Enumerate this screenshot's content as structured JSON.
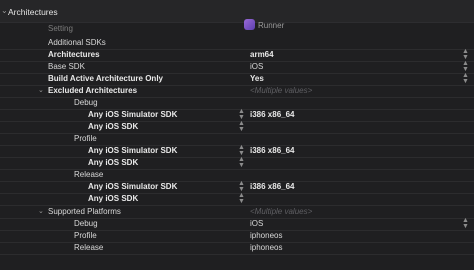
{
  "section": {
    "title": "Architectures"
  },
  "columns": {
    "setting": "Setting",
    "target": "Runner"
  },
  "rows": {
    "additional_sdks": {
      "name": "Additional SDKs",
      "value": ""
    },
    "architectures": {
      "name": "Architectures",
      "value": "arm64"
    },
    "base_sdk": {
      "name": "Base SDK",
      "value": "iOS"
    },
    "build_active_arch": {
      "name": "Build Active Architecture Only",
      "value": "Yes"
    },
    "excluded": {
      "name": "Excluded Architectures",
      "value": "<Multiple values>"
    },
    "ex_debug": {
      "name": "Debug"
    },
    "ex_debug_sim": {
      "name": "Any iOS Simulator SDK",
      "value": "i386 x86_64"
    },
    "ex_debug_sdk": {
      "name": "Any iOS SDK",
      "value": ""
    },
    "ex_profile": {
      "name": "Profile"
    },
    "ex_profile_sim": {
      "name": "Any iOS Simulator SDK",
      "value": "i386 x86_64"
    },
    "ex_profile_sdk": {
      "name": "Any iOS SDK",
      "value": ""
    },
    "ex_release": {
      "name": "Release"
    },
    "ex_release_sim": {
      "name": "Any iOS Simulator SDK",
      "value": "i386 x86_64"
    },
    "ex_release_sdk": {
      "name": "Any iOS SDK",
      "value": ""
    },
    "supported": {
      "name": "Supported Platforms",
      "value": "<Multiple values>"
    },
    "sp_debug": {
      "name": "Debug",
      "value": "iOS"
    },
    "sp_profile": {
      "name": "Profile",
      "value": "iphoneos"
    },
    "sp_release": {
      "name": "Release",
      "value": "iphoneos"
    }
  },
  "icons": {
    "section_disclosure": "chevron-down-icon",
    "target": "app-target-icon",
    "stepper": "up-down-stepper-icon"
  },
  "colors": {
    "background": "#1f1f21",
    "header": "#262628",
    "bold_text": "#e9e9e9",
    "placeholder": "#5f5f63"
  }
}
